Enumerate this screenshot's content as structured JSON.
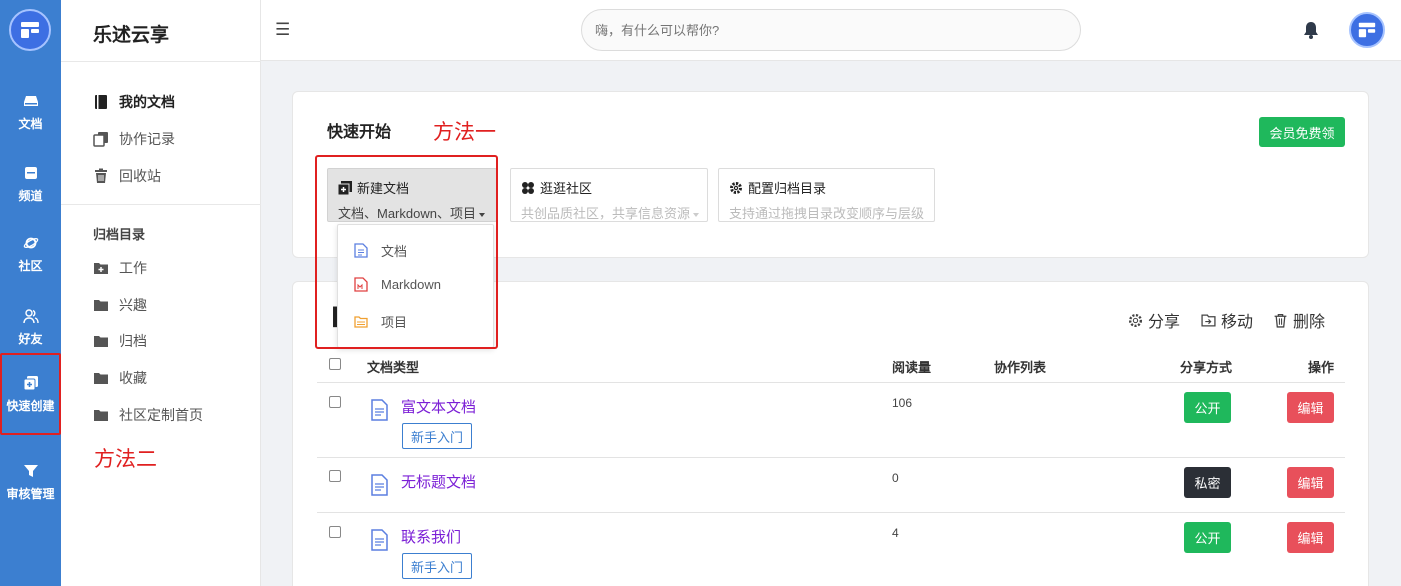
{
  "app": {
    "brand": "乐述云享"
  },
  "rail": [
    {
      "label": "文档",
      "icon": "drive-icon"
    },
    {
      "label": "频道",
      "icon": "inbox-icon"
    },
    {
      "label": "社区",
      "icon": "planet-icon"
    },
    {
      "label": "好友",
      "icon": "friends-icon"
    },
    {
      "label": "快速创建",
      "icon": "add-box-icon"
    },
    {
      "label": "审核管理",
      "icon": "filter-icon"
    }
  ],
  "sidebar": {
    "items": [
      {
        "label": "我的文档",
        "icon": "book-icon"
      },
      {
        "label": "协作记录",
        "icon": "collab-icon"
      },
      {
        "label": "回收站",
        "icon": "trash-icon"
      }
    ],
    "section_title": "归档目录",
    "folders": [
      {
        "label": "工作",
        "icon": "folder-plus-icon"
      },
      {
        "label": "兴趣",
        "icon": "folder-icon"
      },
      {
        "label": "归档",
        "icon": "folder-icon"
      },
      {
        "label": "收藏",
        "icon": "folder-icon"
      },
      {
        "label": "社区定制首页",
        "icon": "folder-icon"
      }
    ],
    "annotation": "方法二"
  },
  "header": {
    "search_placeholder": "嗨，有什么可以帮你?"
  },
  "quick_start": {
    "title": "快速开始",
    "annotation": "方法一",
    "vip_label": "会员免费领",
    "new_doc": {
      "title": "新建文档",
      "subtitle": "文档、Markdown、项目"
    },
    "community": {
      "title": "逛逛社区",
      "subtitle": "共创品质社区，共享信息资源"
    },
    "archive": {
      "title": "配置归档目录",
      "subtitle": "支持通过拖拽目录改变顺序与层级"
    },
    "dropdown": [
      {
        "label": "文档",
        "icon": "doc-icon",
        "color": "#5b7fe0"
      },
      {
        "label": "Markdown",
        "icon": "markdown-file-icon",
        "color": "#e04040"
      },
      {
        "label": "项目",
        "icon": "project-folder-icon",
        "color": "#f0a030"
      }
    ]
  },
  "docs": {
    "actions": {
      "share": "分享",
      "move": "移动",
      "delete": "删除"
    },
    "columns": {
      "type": "文档类型",
      "reads": "阅读量",
      "collab": "协作列表",
      "share": "分享方式",
      "ops": "操作"
    },
    "rows": [
      {
        "title": "富文本文档",
        "tag": "新手入门",
        "reads": "106",
        "share": "公开",
        "edit": "编辑"
      },
      {
        "title": "无标题文档",
        "tag": "",
        "reads": "0",
        "share": "私密",
        "edit": "编辑"
      },
      {
        "title": "联系我们",
        "tag": "新手入门",
        "reads": "4",
        "share": "公开",
        "edit": "编辑"
      }
    ]
  },
  "colors": {
    "rail": "#3c7fd0",
    "accent_green": "#1fb85c",
    "accent_red": "#e8505b",
    "title_purple": "#7b1fd6",
    "annotation_red": "#e02020"
  }
}
